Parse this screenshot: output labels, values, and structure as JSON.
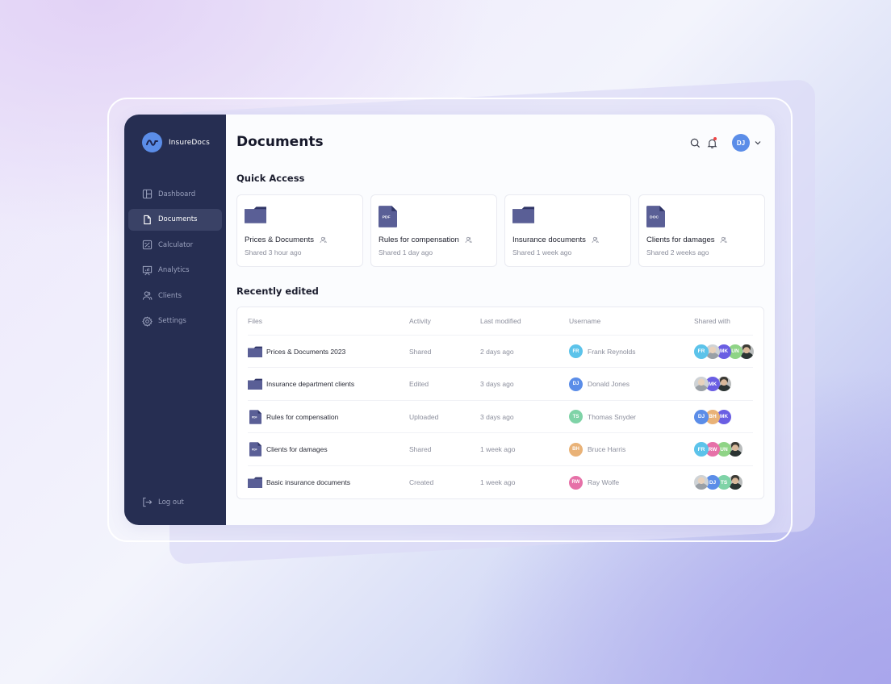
{
  "app": {
    "name": "InsureDocs"
  },
  "sidebar": {
    "items": [
      {
        "label": "Dashboard",
        "icon": "layout-icon",
        "active": false
      },
      {
        "label": "Documents",
        "icon": "file-icon",
        "active": true
      },
      {
        "label": "Calculator",
        "icon": "calculator-icon",
        "active": false
      },
      {
        "label": "Analytics",
        "icon": "presentation-chart-icon",
        "active": false
      },
      {
        "label": "Clients",
        "icon": "users-icon",
        "active": false
      },
      {
        "label": "Settings",
        "icon": "gear-icon",
        "active": false
      }
    ],
    "logout": "Log out"
  },
  "header": {
    "title": "Documents",
    "user_initials": "DJ",
    "icons": [
      "search-icon",
      "bell-icon",
      "chevron-down-icon"
    ]
  },
  "quick_access": {
    "title": "Quick Access",
    "cards": [
      {
        "name": "Prices & Documents",
        "sub": "Shared 3 hour ago",
        "type": "folder"
      },
      {
        "name": "Rules for compensation",
        "sub": "Shared 1 day ago",
        "type": "PDF"
      },
      {
        "name": "Insurance documents",
        "sub": "Shared 1 week ago",
        "type": "folder"
      },
      {
        "name": "Clients for damages",
        "sub": "Shared 2 weeks ago",
        "type": "DOC"
      }
    ]
  },
  "recent": {
    "title": "Recently edited",
    "columns": [
      "Files",
      "Activity",
      "Last modified",
      "Username",
      "Shared with"
    ],
    "rows": [
      {
        "file": "Prices & Documents 2023",
        "type": "folder",
        "activity": "Shared",
        "modified": "2 days ago",
        "user_initials": "FR",
        "user_color": "#5cc3ea",
        "username": "Frank Reynolds",
        "shared": [
          {
            "i": "FR",
            "c": "#5cc3ea"
          },
          {
            "i": "",
            "c": "photo"
          },
          {
            "i": "MK",
            "c": "#6a5ee3"
          },
          {
            "i": "UN",
            "c": "#8fd486"
          },
          {
            "i": "",
            "c": "photo-dark"
          }
        ]
      },
      {
        "file": "Insurance department clients",
        "type": "folder",
        "activity": "Edited",
        "modified": "3 days ago",
        "user_initials": "DJ",
        "user_color": "#5b8de8",
        "username": "Donald Jones",
        "shared": [
          {
            "i": "",
            "c": "photo"
          },
          {
            "i": "MK",
            "c": "#6a5ee3"
          },
          {
            "i": "",
            "c": "photo-dark"
          }
        ]
      },
      {
        "file": "Rules for compensation",
        "type": "PDF",
        "activity": "Uploaded",
        "modified": "3 days ago",
        "user_initials": "TS",
        "user_color": "#7fd3a7",
        "username": "Thomas Snyder",
        "shared": [
          {
            "i": "DJ",
            "c": "#5b8de8"
          },
          {
            "i": "BH",
            "c": "#e9b277"
          },
          {
            "i": "MK",
            "c": "#6a5ee3"
          }
        ]
      },
      {
        "file": "Clients for damages",
        "type": "PDF",
        "activity": "Shared",
        "modified": "1 week ago",
        "user_initials": "BH",
        "user_color": "#e9b277",
        "username": "Bruce Harris",
        "shared": [
          {
            "i": "FR",
            "c": "#5cc3ea"
          },
          {
            "i": "RW",
            "c": "#e671a8"
          },
          {
            "i": "UN",
            "c": "#8fd486"
          },
          {
            "i": "",
            "c": "photo-dark"
          }
        ]
      },
      {
        "file": "Basic insurance documents",
        "type": "folder",
        "activity": "Created",
        "modified": "1 week ago",
        "user_initials": "RW",
        "user_color": "#e671a8",
        "username": "Ray Wolfe",
        "shared": [
          {
            "i": "",
            "c": "photo"
          },
          {
            "i": "DJ",
            "c": "#5b8de8"
          },
          {
            "i": "TS",
            "c": "#7fd3a7"
          },
          {
            "i": "",
            "c": "photo-dark"
          }
        ]
      }
    ]
  },
  "colors": {
    "sidebar": "#262e52",
    "accent": "#5b8de8",
    "file_icon": "#5a5f96"
  }
}
